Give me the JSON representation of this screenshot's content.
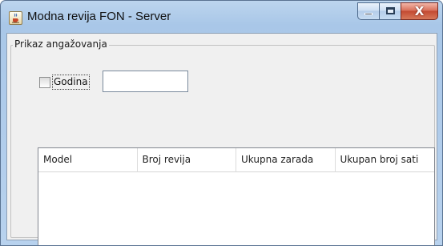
{
  "window": {
    "title": "Modna revija FON - Server",
    "icon": "java-cup-icon",
    "controls": {
      "minimize": "minimize-icon",
      "maximize": "maximize-icon",
      "close_glyph": "X"
    }
  },
  "panel": {
    "title": "Prikaz angažovanja",
    "filter": {
      "label": "Godina",
      "checked": false,
      "value": ""
    }
  },
  "table": {
    "columns": [
      "Model",
      "Broj revija",
      "Ukupna zarada",
      "Ukupan broj sati"
    ],
    "rows": []
  },
  "colors": {
    "title_bar": "#a9c7e8",
    "close_button": "#c34a32",
    "client_bg": "#f0f0f0"
  }
}
